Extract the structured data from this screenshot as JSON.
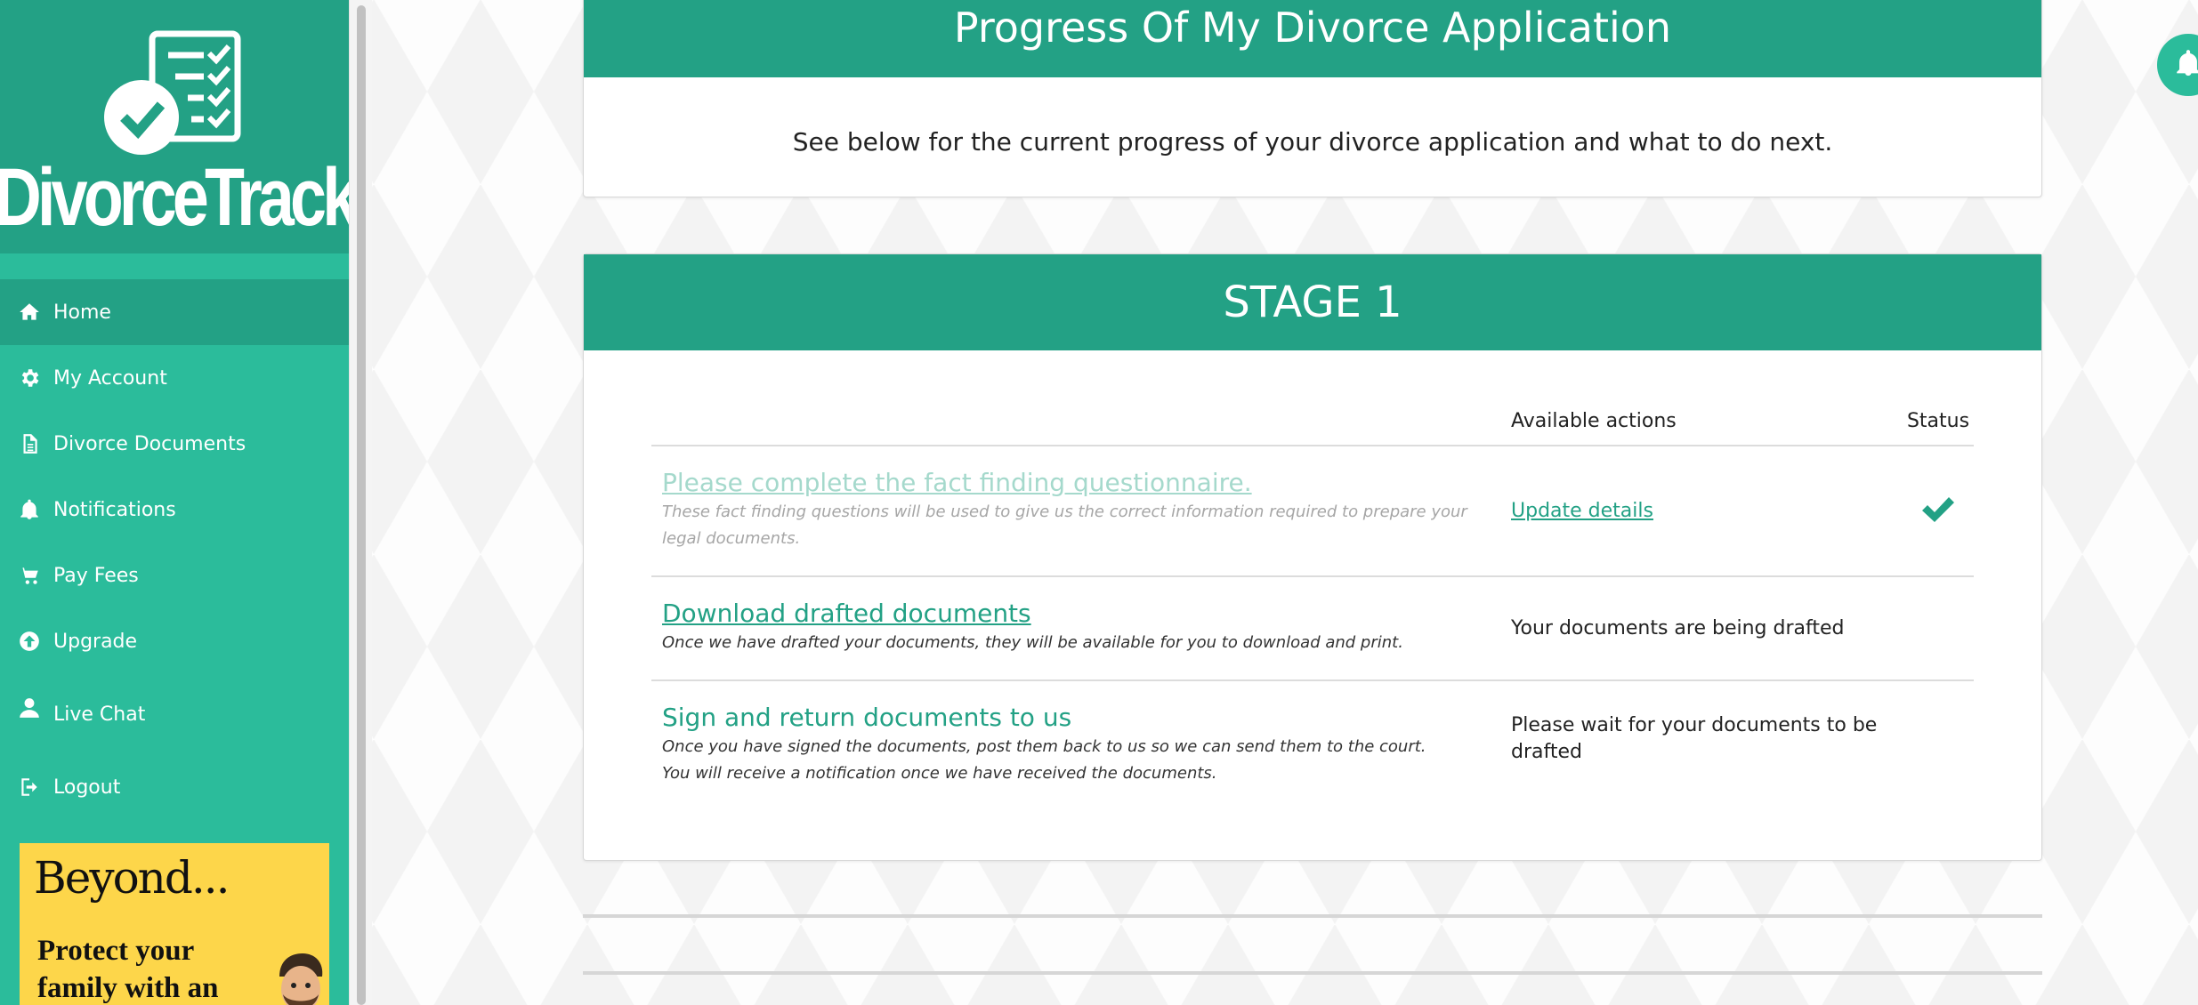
{
  "brand": {
    "logo_text": "DivorceTrack"
  },
  "sidebar": {
    "items": [
      {
        "label": "Home",
        "icon": "home-icon",
        "active": true
      },
      {
        "label": "My Account",
        "icon": "gear-icon"
      },
      {
        "label": "Divorce Documents",
        "icon": "document-icon"
      },
      {
        "label": "Notifications",
        "icon": "bell-icon"
      },
      {
        "label": "Pay Fees",
        "icon": "cart-icon"
      },
      {
        "label": "Upgrade",
        "icon": "upgrade-icon"
      },
      {
        "label": "Live Chat",
        "icon": "user-icon"
      },
      {
        "label": "Logout",
        "icon": "logout-icon"
      }
    ]
  },
  "ad": {
    "title": "Beyond...",
    "text": "Protect your family with an"
  },
  "progress": {
    "title": "Progress Of My Divorce Application",
    "text": "See below for the current progress of your divorce application and what to do next."
  },
  "stage": {
    "title": "STAGE 1",
    "columns": {
      "task": "",
      "actions": "Available actions",
      "status": "Status"
    },
    "rows": [
      {
        "title": "Please complete the fact finding questionnaire.",
        "desc_line1": "These fact finding questions will be used to give us the correct information required to prepare your",
        "desc_line2": "legal documents.",
        "action": "Update details",
        "status_icon": "check-icon"
      },
      {
        "title": "Download drafted documents",
        "desc_line1": "Once we have drafted your documents, they will be available for you to download and print.",
        "action": "Your documents are being drafted"
      },
      {
        "title": "Sign and return documents to us",
        "desc_line1": "Once you have signed the documents, post them back to us so we can send them to the court.",
        "desc_line2": "You will receive a notification once we have received the documents.",
        "action_line1": "Please wait for your documents to be",
        "action_line2": "drafted"
      }
    ]
  },
  "colors": {
    "primary": "#2bbc9b",
    "primary_dark": "#23a185",
    "ad_yellow": "#fdd64a"
  }
}
